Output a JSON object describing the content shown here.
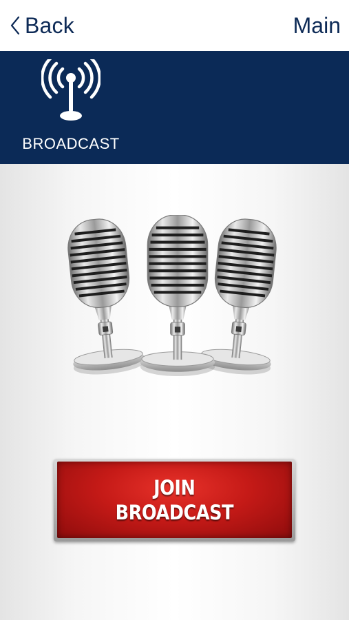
{
  "nav": {
    "back_label": "Back",
    "main_label": "Main"
  },
  "banner": {
    "tile_label": "BROADCAST",
    "tile_icon": "broadcast-antenna-icon"
  },
  "hero": {
    "image": "three-vintage-microphones"
  },
  "join_button": {
    "line1": "JOIN",
    "line2": "BROADCAST"
  },
  "colors": {
    "nav_text": "#0d2a56",
    "banner_bg": "#0b2a57",
    "button_red": "#c51a17"
  }
}
